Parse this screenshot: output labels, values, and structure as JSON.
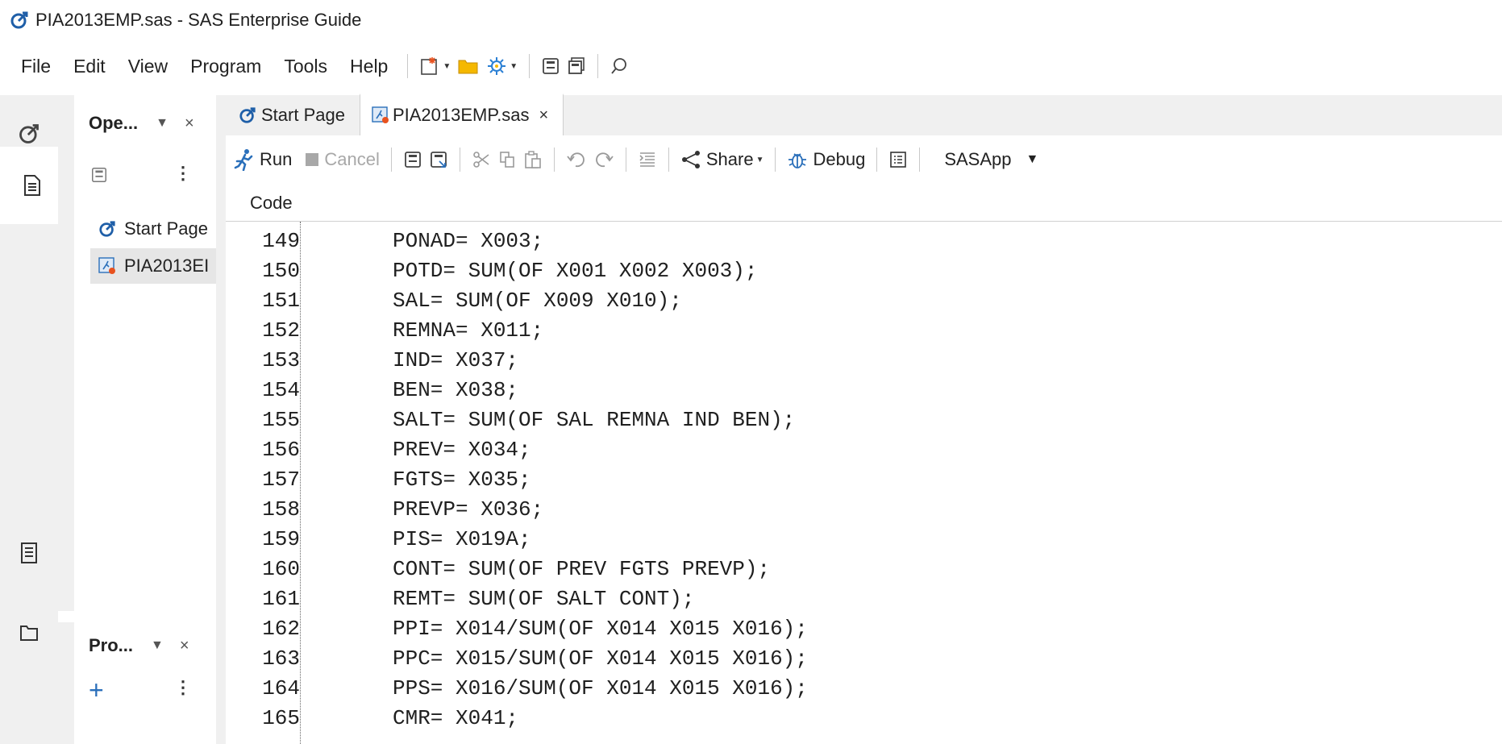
{
  "window": {
    "title": "PIA2013EMP.sas - SAS Enterprise Guide"
  },
  "menu": [
    "File",
    "Edit",
    "View",
    "Program",
    "Tools",
    "Help"
  ],
  "open_panel": {
    "title": "Ope...",
    "items": [
      {
        "label": "Start Page"
      },
      {
        "label": "PIA2013EI"
      }
    ]
  },
  "project_panel": {
    "title": "Pro...",
    "add_label": "+"
  },
  "tabs": [
    {
      "label": "Start Page"
    },
    {
      "label": "PIA2013EMP.sas",
      "close": "×"
    }
  ],
  "program_toolbar": {
    "run": "Run",
    "cancel": "Cancel",
    "share": "Share",
    "debug": "Debug",
    "server": "SASApp"
  },
  "code_header": "Code",
  "code_lines": [
    {
      "n": "149",
      "text": "PONAD= X003;"
    },
    {
      "n": "150",
      "text": "POTD= SUM(OF X001 X002 X003);"
    },
    {
      "n": "151",
      "text": "SAL= SUM(OF X009 X010);"
    },
    {
      "n": "152",
      "text": "REMNA= X011;"
    },
    {
      "n": "153",
      "text": "IND= X037;"
    },
    {
      "n": "154",
      "text": "BEN= X038;"
    },
    {
      "n": "155",
      "text": "SALT= SUM(OF SAL REMNA IND BEN);"
    },
    {
      "n": "156",
      "text": "PREV= X034;"
    },
    {
      "n": "157",
      "text": "FGTS= X035;"
    },
    {
      "n": "158",
      "text": "PREVP= X036;"
    },
    {
      "n": "159",
      "text": "PIS= X019A;"
    },
    {
      "n": "160",
      "text": "CONT= SUM(OF PREV FGTS PREVP);"
    },
    {
      "n": "161",
      "text": "REMT= SUM(OF SALT CONT);"
    },
    {
      "n": "162",
      "text": "PPI= X014/SUM(OF X014 X015 X016);"
    },
    {
      "n": "163",
      "text": "PPC= X015/SUM(OF X014 X015 X016);"
    },
    {
      "n": "164",
      "text": "PPS= X016/SUM(OF X014 X015 X016);"
    },
    {
      "n": "165",
      "text": "CMR= X041;"
    }
  ],
  "colors": {
    "accent": "#1f5fa8",
    "rail": "#f0f0f0",
    "sas_orange": "#e8521f"
  }
}
